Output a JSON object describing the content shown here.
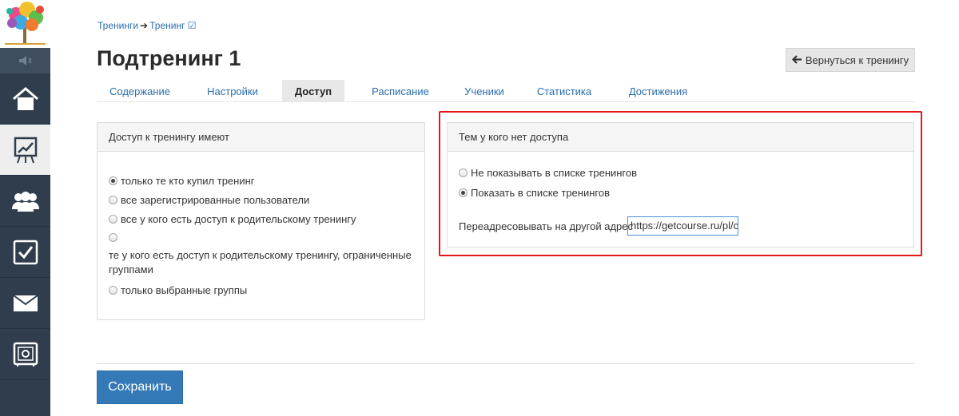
{
  "breadcrumb": {
    "items": [
      "Тренинги",
      "Тренинг ☑"
    ],
    "separator": "➔"
  },
  "page_title": "Подтренинг 1",
  "back_button": {
    "label": "Вернуться к тренингу",
    "icon": "arrow-left-icon"
  },
  "tabs": [
    {
      "label": "Содержание",
      "active": false
    },
    {
      "label": "Настройки",
      "active": false
    },
    {
      "label": "Доступ",
      "active": true
    },
    {
      "label": "Расписание",
      "active": false
    },
    {
      "label": "Ученики",
      "active": false
    },
    {
      "label": "Статистика",
      "active": false
    },
    {
      "label": "Достижения",
      "active": false
    }
  ],
  "access_panel": {
    "title": "Доступ к тренингу имеют",
    "options": [
      {
        "label": "только те кто купил тренинг",
        "checked": true
      },
      {
        "label": "все зарегистрированные пользователи",
        "checked": false
      },
      {
        "label": "все у кого есть доступ к родительскому тренингу",
        "checked": false
      },
      {
        "label": "те у кого есть доступ к родительскому тренингу, ограниченные группами",
        "checked": false
      },
      {
        "label": "только выбранные группы",
        "checked": false
      }
    ]
  },
  "no_access_panel": {
    "title": "Тем у кого нет доступа",
    "options": [
      {
        "label": "Не показывать в списке тренингов",
        "checked": false
      },
      {
        "label": "Показать в списке тренингов",
        "checked": true
      }
    ],
    "redirect_label": "Переадресовывать на другой адрес",
    "redirect_value": "https://getcourse.ru/pl/cm"
  },
  "save_button": {
    "label": "Сохранить"
  },
  "sidebar": {
    "icons": [
      "speaker-icon",
      "home-icon",
      "chart-icon",
      "users-icon",
      "checkbox-icon",
      "mail-icon",
      "safe-icon"
    ],
    "active": "chart-icon"
  },
  "colors": {
    "sidebar_bg": "#2f3d4c",
    "link": "#2a6ead",
    "primary_button": "#337ab7",
    "highlight_frame": "#e3161a"
  }
}
